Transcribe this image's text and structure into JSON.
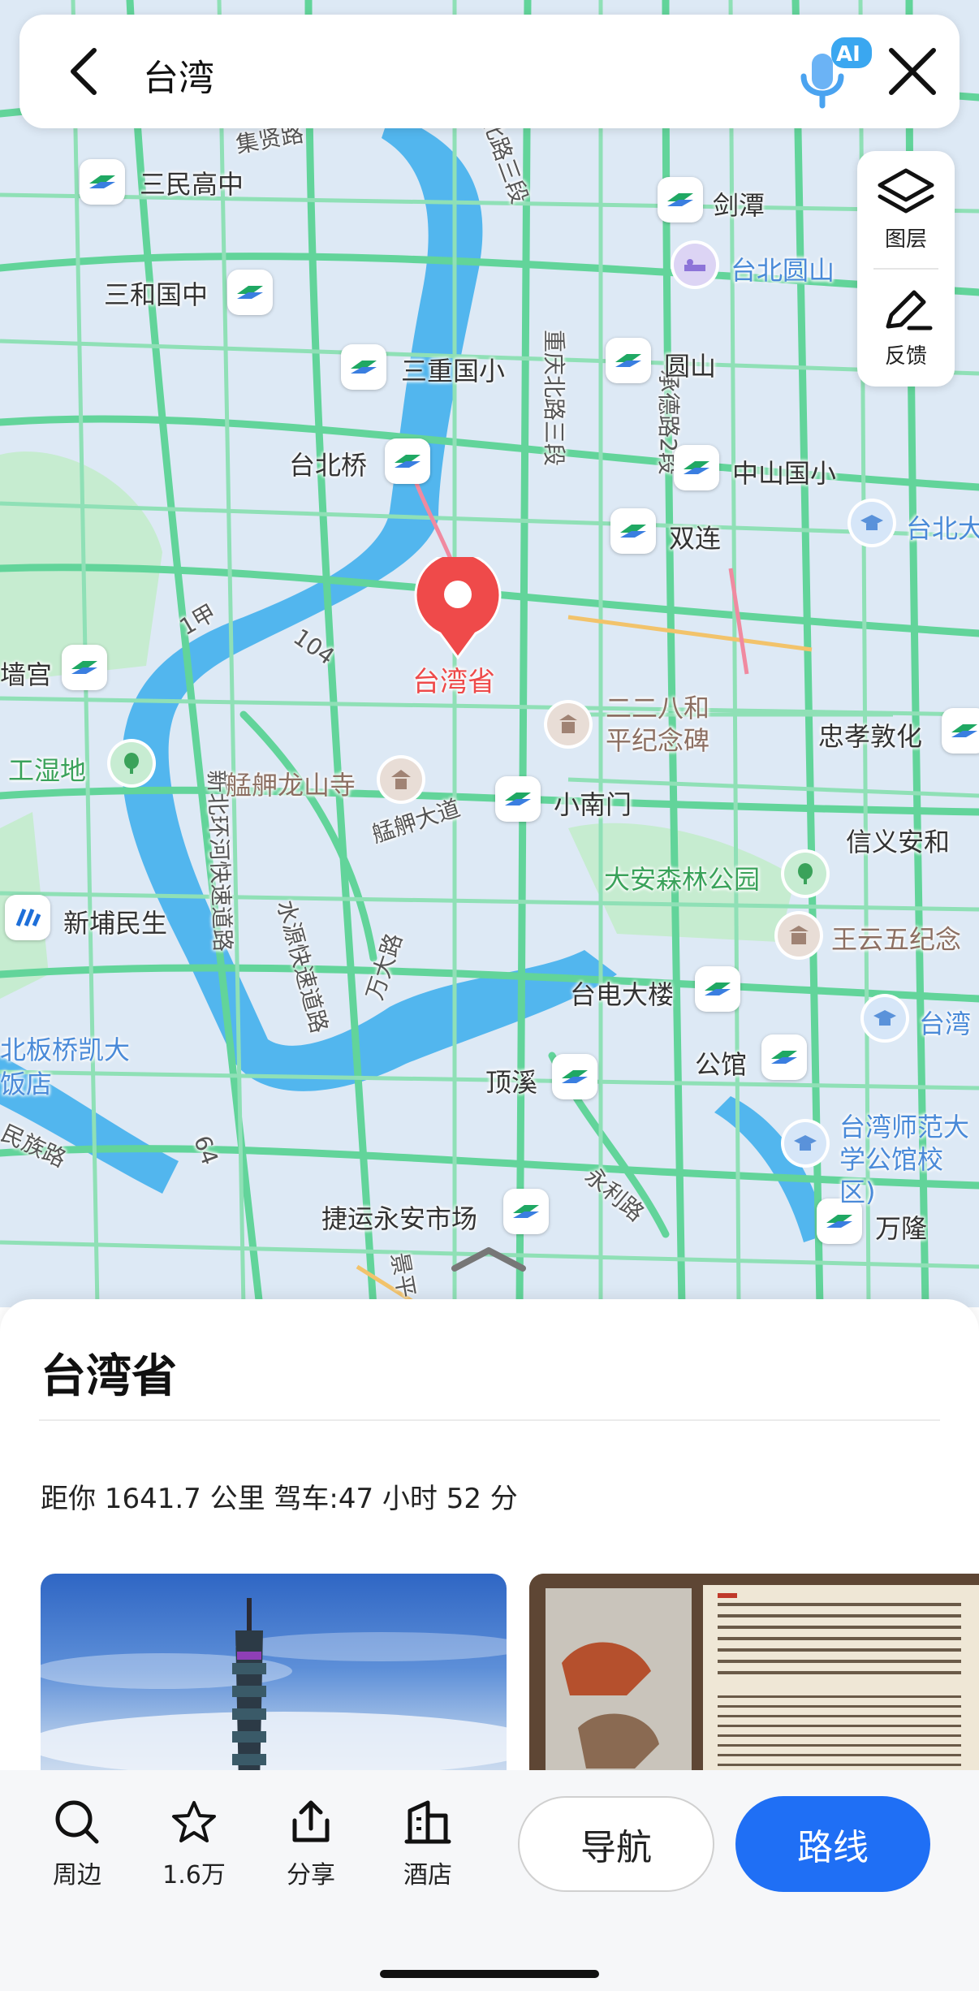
{
  "search": {
    "query": "台湾"
  },
  "ai_badge": "AI",
  "side_controls": {
    "layers_label": "图层",
    "feedback_label": "反馈"
  },
  "map": {
    "pin_label": "台湾省",
    "metro_stations": [
      "三民高中",
      "三和国中",
      "三重国小",
      "台北桥",
      "剑潭",
      "圆山",
      "中山国小",
      "双连",
      "小南门",
      "台电大楼",
      "公馆",
      "顶溪",
      "捷运永安市场",
      "万隆",
      "忠孝敦化",
      "信义安和",
      "新埔民生",
      "墙宫"
    ],
    "pois": [
      "台北圆山",
      "二二八和平纪念碑",
      "艋舺龙山寺",
      "大安森林公园",
      "王云五纪念",
      "台湾师范大学公馆校区)",
      "台北大",
      "台湾",
      "工湿地",
      "北板桥凯大饭店"
    ],
    "roads": [
      "环河北路三段",
      "重庆北路三段",
      "承德路2段",
      "艋舺大道",
      "水源快速道路",
      "万大路",
      "新北环河快速道路",
      "永利路",
      "民族路",
      "集贤路",
      "104",
      "1甲",
      "64",
      "景平"
    ]
  },
  "place": {
    "title": "台湾省",
    "distance": "距你 1641.7 公里  驾车:47 小时 52 分"
  },
  "bottom_bar": {
    "nearby": "周边",
    "favorites": "1.6万",
    "share": "分享",
    "hotel": "酒店",
    "navigate": "导航",
    "route": "路线"
  },
  "colors": {
    "accent": "#1f6ff5",
    "pin": "#ef4a4a",
    "road": "#5fd69a",
    "water": "#4cb4ee",
    "metro": "#1fa863"
  }
}
